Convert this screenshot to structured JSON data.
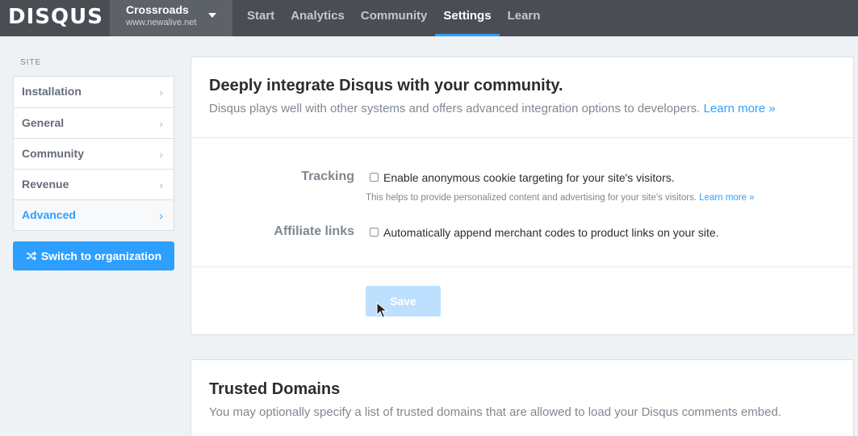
{
  "app": {
    "logo_text": "DISQUS"
  },
  "site": {
    "name": "Crossroads",
    "url": "www.newalive.net"
  },
  "nav": {
    "items": [
      {
        "label": "Start"
      },
      {
        "label": "Analytics"
      },
      {
        "label": "Community"
      },
      {
        "label": "Settings",
        "active": true
      },
      {
        "label": "Learn"
      }
    ]
  },
  "sidebar": {
    "heading": "SITE",
    "items": [
      {
        "label": "Installation"
      },
      {
        "label": "General"
      },
      {
        "label": "Community"
      },
      {
        "label": "Revenue"
      },
      {
        "label": "Advanced",
        "active": true
      }
    ],
    "chevron": "›",
    "switch_button": "Switch to organization",
    "switch_icon": "shuffle-icon"
  },
  "integrate": {
    "title": "Deeply integrate Disqus with your community.",
    "description": "Disqus plays well with other systems and offers advanced integration options to developers. ",
    "learn_more": "Learn more »",
    "tracking": {
      "label": "Tracking",
      "checkbox_label": "Enable anonymous cookie targeting for your site's visitors.",
      "checked": false,
      "help": "This helps to provide personalized content and advertising for your site's visitors. ",
      "help_link": "Learn more »"
    },
    "affiliate": {
      "label": "Affiliate links",
      "checkbox_label": "Automatically append merchant codes to product links on your site.",
      "checked": false
    },
    "save_label": "Save"
  },
  "trusted": {
    "title": "Trusted Domains",
    "description": "You may optionally specify a list of trusted domains that are allowed to load your Disqus comments embed."
  },
  "colors": {
    "accent": "#2e9fff",
    "topbar": "#4a4e54",
    "background": "#eff2f4"
  }
}
